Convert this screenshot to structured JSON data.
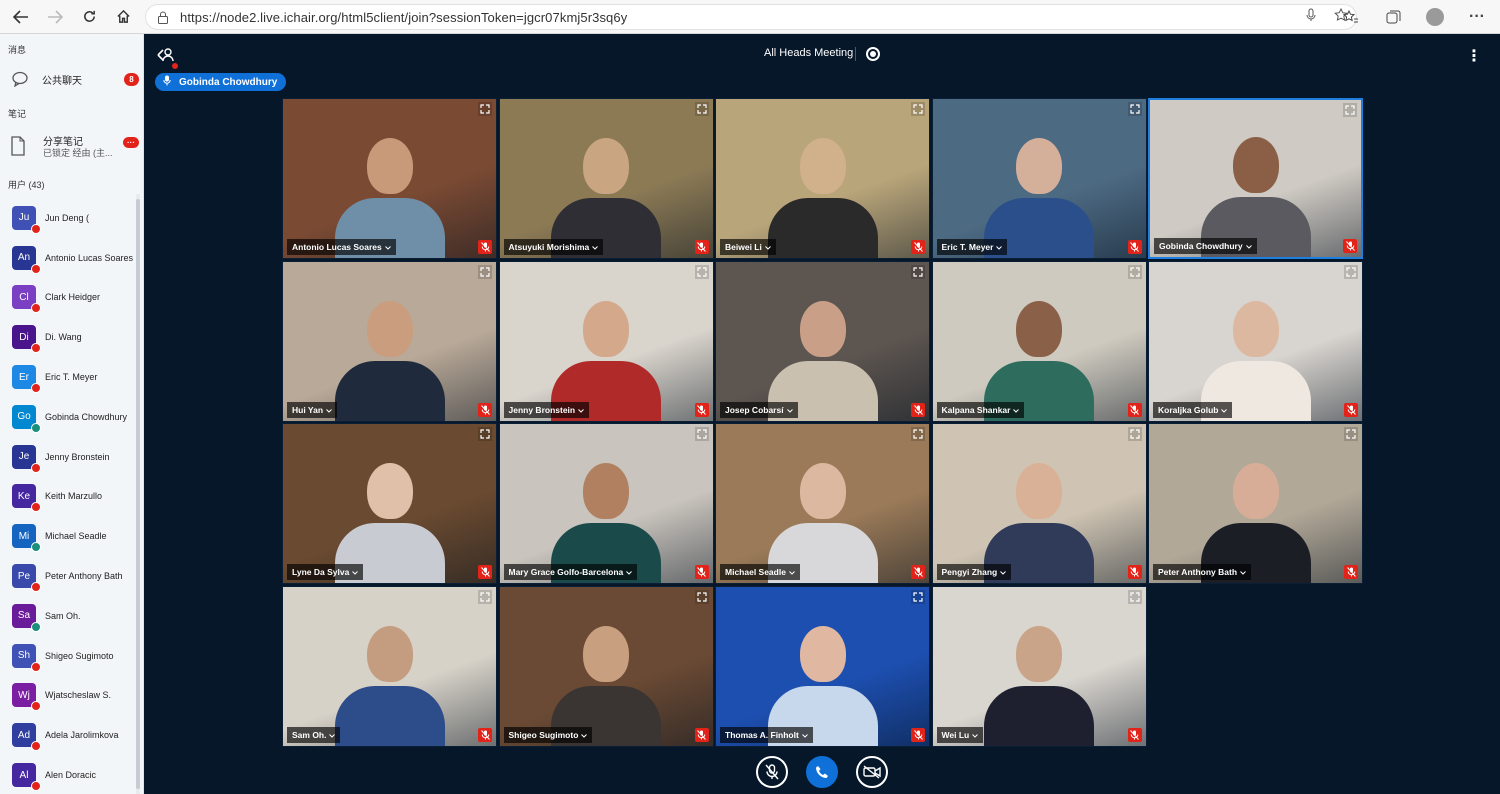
{
  "browser": {
    "url": "https://node2.live.ichair.org/html5client/join?sessionToken=jgcr07kmj5r3sq6y"
  },
  "sidebar": {
    "messages_title": "消息",
    "public_chat": "公共聊天",
    "public_chat_unread": "8",
    "notes_title": "笔记",
    "shared_notes": "分享笔记",
    "shared_notes_status": "已锁定 经由 (主...",
    "shared_notes_badge": "···",
    "users_title": "用户 (43)",
    "users": [
      {
        "initials": "Ju",
        "name": "Jun Deng (",
        "color": "#3f51b5",
        "mic": "muted"
      },
      {
        "initials": "An",
        "name": "Antonio Lucas Soares",
        "color": "#283593",
        "mic": "muted"
      },
      {
        "initials": "Cl",
        "name": "Clark Heidger",
        "color": "#7b3fc4",
        "mic": "muted"
      },
      {
        "initials": "Di",
        "name": "Di. Wang",
        "color": "#4a148c",
        "mic": "muted"
      },
      {
        "initials": "Er",
        "name": "Eric T. Meyer",
        "color": "#1e88e5",
        "mic": "muted"
      },
      {
        "initials": "Go",
        "name": "Gobinda Chowdhury",
        "color": "#0288d1",
        "mic": "on"
      },
      {
        "initials": "Je",
        "name": "Jenny Bronstein",
        "color": "#283593",
        "mic": "muted"
      },
      {
        "initials": "Ke",
        "name": "Keith Marzullo",
        "color": "#4527a0",
        "mic": "muted"
      },
      {
        "initials": "Mi",
        "name": "Michael Seadle",
        "color": "#1565c0",
        "mic": "on"
      },
      {
        "initials": "Pe",
        "name": "Peter Anthony Bath",
        "color": "#3949ab",
        "mic": "muted"
      },
      {
        "initials": "Sa",
        "name": "Sam Oh.",
        "color": "#6a1b9a",
        "mic": "on"
      },
      {
        "initials": "Sh",
        "name": "Shigeo Sugimoto",
        "color": "#3f51b5",
        "mic": "muted"
      },
      {
        "initials": "Wj",
        "name": "Wjatscheslaw S.",
        "color": "#7b1fa2",
        "mic": "muted"
      },
      {
        "initials": "Ad",
        "name": "Adela Jarolimkova",
        "color": "#303f9f",
        "mic": "muted"
      },
      {
        "initials": "Al",
        "name": "Alen Doracic",
        "color": "#4527a0",
        "mic": "muted"
      }
    ]
  },
  "meeting": {
    "title": "All Heads Meeting",
    "talking_indicator": "Gobinda Chowdhury"
  },
  "tiles": [
    {
      "name": "Antonio Lucas Soares",
      "bg": "#7a4a33",
      "skin": "#c89a7a",
      "shirt": "#6f8fa8",
      "active": false
    },
    {
      "name": "Atsuyuki Morishima",
      "bg": "#8c7a55",
      "skin": "#c9a582",
      "shirt": "#2e2e34",
      "active": false
    },
    {
      "name": "Beiwei Li",
      "bg": "#b9a57a",
      "skin": "#d1b08c",
      "shirt": "#2a2a2a",
      "active": false
    },
    {
      "name": "Eric T. Meyer",
      "bg": "#4d6a83",
      "skin": "#d4b09a",
      "shirt": "#2a4f8a",
      "active": false
    },
    {
      "name": "Gobinda Chowdhury",
      "bg": "#cfcac3",
      "skin": "#8a5f45",
      "shirt": "#5a5a60",
      "active": true
    },
    {
      "name": "Hui Yan",
      "bg": "#b9a998",
      "skin": "#c99d7d",
      "shirt": "#1f2a3c",
      "active": false
    },
    {
      "name": "Jenny Bronstein",
      "bg": "#d9d4cc",
      "skin": "#d4a88a",
      "shirt": "#b02a2a",
      "active": false
    },
    {
      "name": "Josep Cobarsí",
      "bg": "#5d5550",
      "skin": "#c9a087",
      "shirt": "#c9c0b0",
      "active": false
    },
    {
      "name": "Kalpana Shankar",
      "bg": "#cfcabf",
      "skin": "#8b6048",
      "shirt": "#2e6d5e",
      "active": false
    },
    {
      "name": "Koraljka Golub",
      "bg": "#d8d4cf",
      "skin": "#dcb8a0",
      "shirt": "#efe8e0",
      "active": false
    },
    {
      "name": "Lyne Da Sylva",
      "bg": "#6a4a30",
      "skin": "#e0c0a8",
      "shirt": "#c8ccd2",
      "active": false
    },
    {
      "name": "Mary Grace Golfo-Barcelona",
      "bg": "#c9c4bd",
      "skin": "#b08060",
      "shirt": "#1b4a4a",
      "active": false
    },
    {
      "name": "Michael Seadle",
      "bg": "#9a7a58",
      "skin": "#ddb8a0",
      "shirt": "#d8d8da",
      "active": false
    },
    {
      "name": "Pengyi Zhang",
      "bg": "#cfc4b3",
      "skin": "#d9b196",
      "shirt": "#2f3b58",
      "active": false
    },
    {
      "name": "Peter Anthony Bath",
      "bg": "#b2a898",
      "skin": "#d7ad98",
      "shirt": "#1c1e26",
      "active": false
    },
    {
      "name": "Sam Oh.",
      "bg": "#d7d2c8",
      "skin": "#c49d80",
      "shirt": "#2d4c8a",
      "active": false
    },
    {
      "name": "Shigeo Sugimoto",
      "bg": "#6a4a34",
      "skin": "#c8a080",
      "shirt": "#3a3432",
      "active": false
    },
    {
      "name": "Thomas A. Finholt",
      "bg": "#1d4fb0",
      "skin": "#e0b8a2",
      "shirt": "#c8d8ec",
      "active": false
    },
    {
      "name": "Wei Lu",
      "bg": "#d9d5cf",
      "skin": "#c9a488",
      "shirt": "#1e2030",
      "active": false
    }
  ],
  "icons": {
    "back": "←",
    "forward": "→",
    "refresh": "↻",
    "home": "⌂",
    "expand": "⤢",
    "mute": "🎤",
    "kebab": "⋮"
  }
}
